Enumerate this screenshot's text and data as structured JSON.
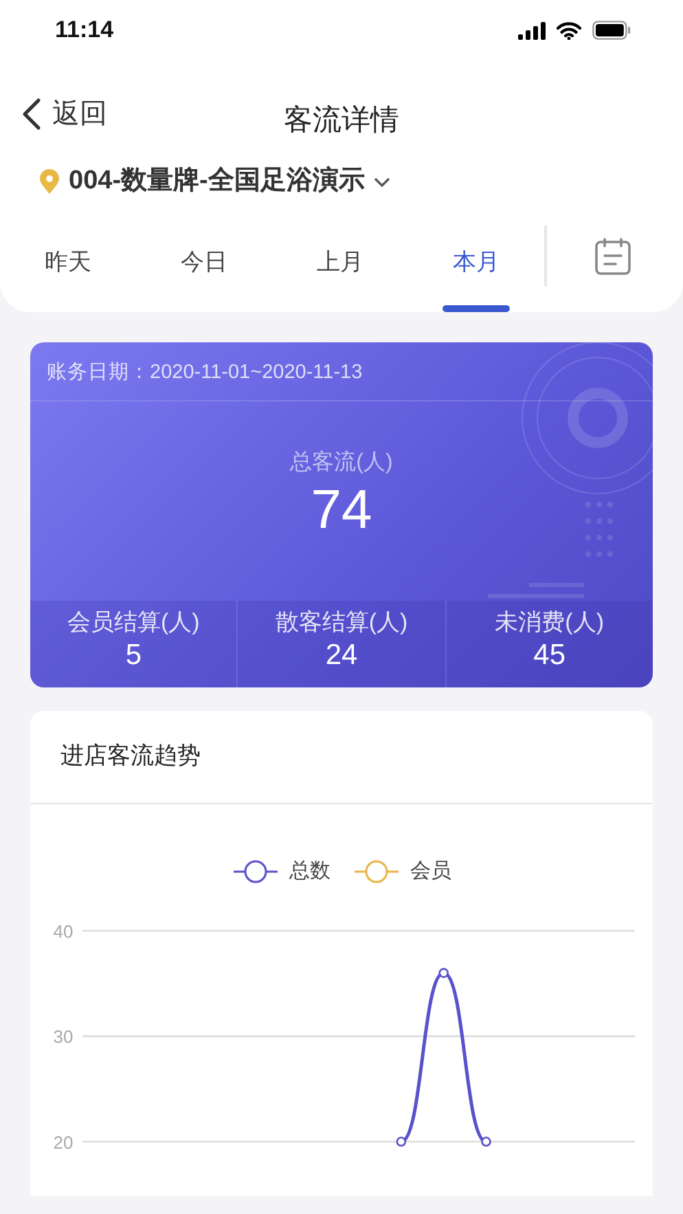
{
  "status_bar": {
    "time": "11:14"
  },
  "nav": {
    "back_label": "返回",
    "title": "客流详情"
  },
  "store": {
    "name": "004-数量牌-全国足浴演示"
  },
  "tabs": [
    {
      "label": "昨天",
      "selected": false
    },
    {
      "label": "今日",
      "selected": false
    },
    {
      "label": "上月",
      "selected": false
    },
    {
      "label": "本月",
      "selected": true
    }
  ],
  "summary": {
    "date_label": "账务日期：2020-11-01~2020-11-13",
    "total_label": "总客流(人)",
    "total_value": "74",
    "stats": [
      {
        "label": "会员结算(人)",
        "value": "5"
      },
      {
        "label": "散客结算(人)",
        "value": "24"
      },
      {
        "label": "未消费(人)",
        "value": "45"
      }
    ]
  },
  "trend": {
    "title": "进店客流趋势",
    "chart_data": {
      "type": "line",
      "ylim": [
        20,
        40
      ],
      "yticks": [
        20,
        30,
        40
      ],
      "series": [
        {
          "name": "总数",
          "color": "#5a52cc",
          "marker": true,
          "values": [
            null,
            null,
            null,
            null,
            null,
            null,
            null,
            20,
            36,
            20,
            null,
            null,
            null
          ]
        },
        {
          "name": "会员",
          "color": "#e8b54a",
          "marker": true,
          "values": [
            null,
            null,
            null,
            null,
            null,
            null,
            null,
            null,
            null,
            null,
            null,
            null,
            null
          ]
        }
      ]
    }
  }
}
